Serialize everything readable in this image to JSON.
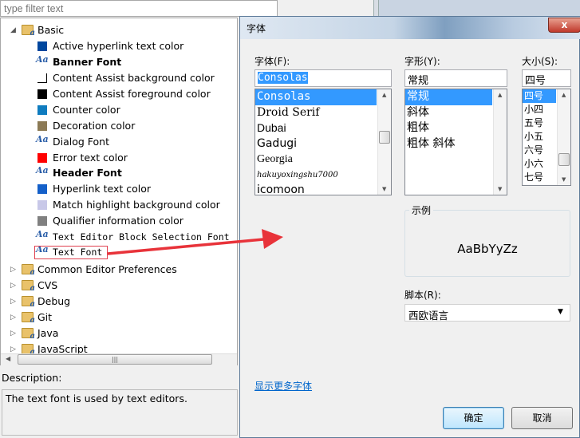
{
  "filter": {
    "placeholder": "type filter text"
  },
  "tree": {
    "basic": "Basic",
    "children": [
      {
        "label": "Active hyperlink text color",
        "type": "color",
        "color": "#00479e"
      },
      {
        "label": "Banner Font",
        "type": "font",
        "bold": true
      },
      {
        "label": "Content Assist background color",
        "type": "color",
        "color": "#ffffff"
      },
      {
        "label": "Content Assist foreground color",
        "type": "color",
        "color": "#000000"
      },
      {
        "label": "Counter color",
        "type": "color",
        "color": "#0f7cbf"
      },
      {
        "label": "Decoration color",
        "type": "color",
        "color": "#8c7a55"
      },
      {
        "label": "Dialog Font",
        "type": "font"
      },
      {
        "label": "Error text color",
        "type": "color",
        "color": "#ff0000"
      },
      {
        "label": "Header Font",
        "type": "font",
        "bold": true
      },
      {
        "label": "Hyperlink text color",
        "type": "color",
        "color": "#1460c9"
      },
      {
        "label": "Match highlight background color",
        "type": "color",
        "color": "#c8c8e8"
      },
      {
        "label": "Qualifier information color",
        "type": "color",
        "color": "#808080"
      },
      {
        "label": "Text Editor Block Selection Font",
        "type": "font",
        "mono": true
      },
      {
        "label": "Text Font",
        "type": "font",
        "mono": true,
        "highlighted": true
      }
    ],
    "categories": [
      "Common Editor Preferences",
      "CVS",
      "Debug",
      "Git",
      "Java",
      "JavaScript"
    ]
  },
  "description": {
    "label": "Description:",
    "text": "The text font is used by text editors."
  },
  "dialog": {
    "title": "字体",
    "close": "x",
    "font_label": "字体(F):",
    "font_value": "Consolas",
    "fonts": [
      "Consolas",
      "Droid Serif",
      "Dubai",
      "Gadugi",
      "Georgia",
      "hakuyoxingshu7000",
      "icomoon"
    ],
    "style_label": "字形(Y):",
    "style_value": "常规",
    "styles": [
      "常规",
      "斜体",
      "粗体",
      "粗体 斜体"
    ],
    "size_label": "大小(S):",
    "size_value": "四号",
    "sizes": [
      "四号",
      "小四",
      "五号",
      "小五",
      "六号",
      "小六",
      "七号"
    ],
    "sample_label": "示例",
    "sample_text": "AaBbYyZz",
    "script_label": "脚本(R):",
    "script_value": "西欧语言",
    "more_fonts": "显示更多字体",
    "ok": "确定",
    "cancel": "取消"
  },
  "annotation_color": "#e8333a"
}
